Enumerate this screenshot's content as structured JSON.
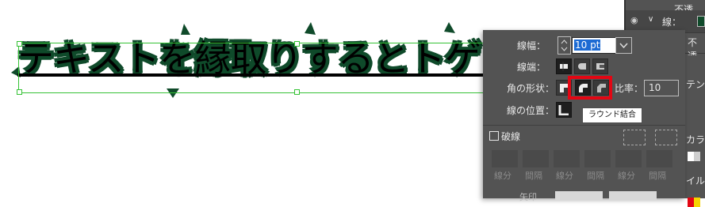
{
  "artwork": {
    "text": "テキストを縁取りするとトゲトゲ"
  },
  "layers_panel": {
    "row1_label": "不透",
    "row2_label": "線：",
    "row3_label": "不透",
    "side_label_1": "テン",
    "side_label_2": "カラ",
    "side_label_3": "イル"
  },
  "stroke_panel": {
    "weight_label": "線幅：",
    "weight_value": "10 pt",
    "cap_label": "線端：",
    "corner_label": "角の形状：",
    "ratio_label": "比率：",
    "ratio_value": "10",
    "align_label": "線の位置：",
    "tooltip": "ラウンド結合",
    "dashed_label": "破線",
    "dash_labels": [
      "線分",
      "間隔",
      "線分",
      "間隔",
      "線分",
      "間隔"
    ],
    "bottom_label": "矢印"
  },
  "colors": {
    "text_fill": "#0f4a2a",
    "highlight": "#e30613",
    "selection": "#35c235",
    "panel_bg": "#535353"
  }
}
